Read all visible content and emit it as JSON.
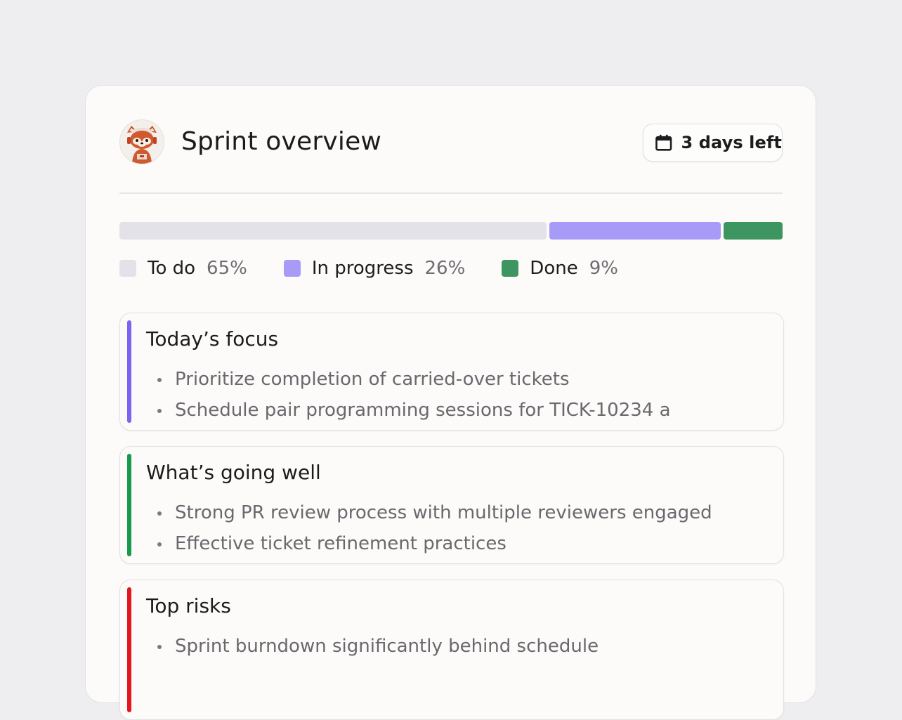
{
  "header": {
    "title": "Sprint overview",
    "days_left": "3 days left"
  },
  "status": {
    "segments": [
      {
        "key": "todo",
        "label": "To do",
        "percent_label": "65%",
        "value": 65,
        "color": "#e3e2e8"
      },
      {
        "key": "in_progress",
        "label": "In progress",
        "percent_label": "26%",
        "value": 26,
        "color": "#a89bf7"
      },
      {
        "key": "done",
        "label": "Done",
        "percent_label": "9%",
        "value": 9,
        "color": "#3d955f"
      }
    ]
  },
  "cards": {
    "focus": {
      "title": "Today’s focus",
      "accent": "#7b64f0",
      "items": [
        "Prioritize completion of carried-over tickets",
        "Schedule pair programming sessions for TICK-10234 a"
      ]
    },
    "well": {
      "title": "What’s going well",
      "accent": "#179a4c",
      "items": [
        "Strong PR review process with multiple reviewers engaged",
        "Effective ticket refinement practices"
      ]
    },
    "risks": {
      "title": "Top risks",
      "accent": "#e4161b",
      "items": [
        "Sprint burndown significantly behind schedule"
      ]
    }
  },
  "icons": {
    "avatar": "red-panda-avatar-icon",
    "calendar": "calendar-icon"
  }
}
